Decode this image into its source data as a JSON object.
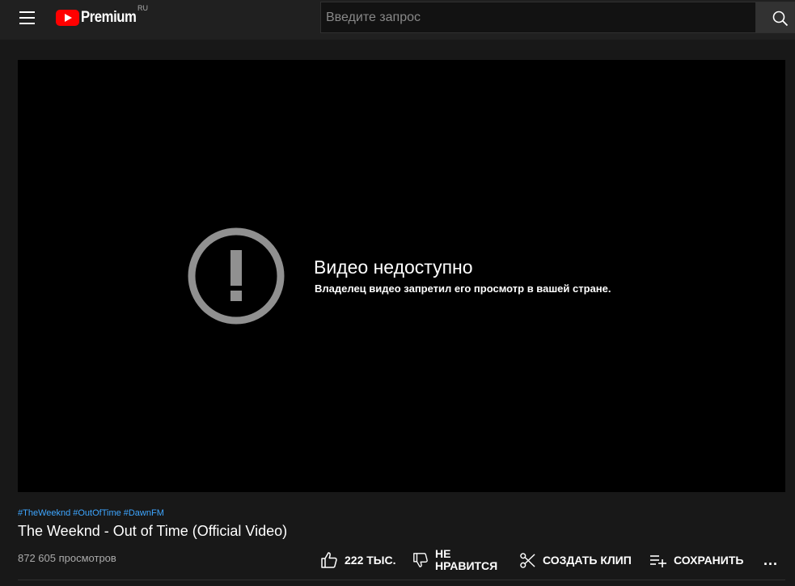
{
  "header": {
    "logo_text": "Premium",
    "logo_country": "RU",
    "search_placeholder": "Введите запрос"
  },
  "player": {
    "error_title": "Видео недоступно",
    "error_subtitle": "Владелец видео запретил его просмотр в вашей стране."
  },
  "video": {
    "hashtags": [
      "#TheWeeknd",
      "#OutOfTime",
      "#DawnFM"
    ],
    "title": "The Weeknd - Out of Time (Official Video)",
    "views": "872 605 просмотров"
  },
  "actions": {
    "like_label": "222 ТЫС.",
    "dislike_label": "НЕ НРАВИТСЯ",
    "clip_label": "СОЗДАТЬ КЛИП",
    "save_label": "СОХРАНИТЬ",
    "more_label": "..."
  },
  "colors": {
    "background": "#181818",
    "header": "#202020",
    "brand_red": "#ff0000",
    "link_blue": "#3ea6ff",
    "secondary_text": "#aaaaaa"
  },
  "icons": [
    "menu-icon",
    "youtube-logo-icon",
    "search-icon",
    "error-icon",
    "thumb-up-icon",
    "thumb-down-icon",
    "scissors-icon",
    "playlist-add-icon",
    "more-icon"
  ]
}
